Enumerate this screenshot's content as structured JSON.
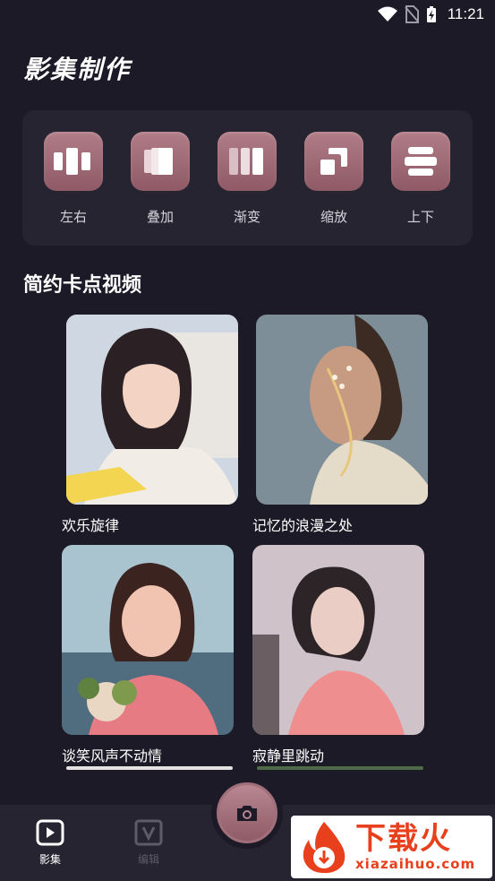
{
  "status_bar": {
    "time": "11:21",
    "icons": [
      "wifi-icon",
      "no-sim-icon",
      "battery-charging-icon"
    ]
  },
  "page": {
    "title": "影集制作"
  },
  "effects": [
    {
      "label": "左右",
      "icon": "left-right-icon"
    },
    {
      "label": "叠加",
      "icon": "overlay-icon"
    },
    {
      "label": "渐变",
      "icon": "gradient-icon"
    },
    {
      "label": "缩放",
      "icon": "zoom-icon"
    },
    {
      "label": "上下",
      "icon": "up-down-icon"
    }
  ],
  "section": {
    "title": "简约卡点视频"
  },
  "templates": [
    {
      "title": "欢乐旋律"
    },
    {
      "title": "记忆的浪漫之处"
    },
    {
      "title": "谈笑风声不动情"
    },
    {
      "title": "寂静里跳动"
    }
  ],
  "bottom_nav": {
    "items": [
      {
        "label": "影集",
        "icon": "album-play-icon",
        "active": true
      },
      {
        "label": "编辑",
        "icon": "edit-v-icon",
        "active": false
      }
    ],
    "camera": {
      "icon": "camera-icon"
    }
  },
  "watermark": {
    "main": "下载火",
    "sub": "xiazaihuo.com"
  },
  "colors": {
    "background": "#1c1a26",
    "panel": "#262431",
    "accent": "#a06f7a",
    "watermark": "#e8401c"
  }
}
